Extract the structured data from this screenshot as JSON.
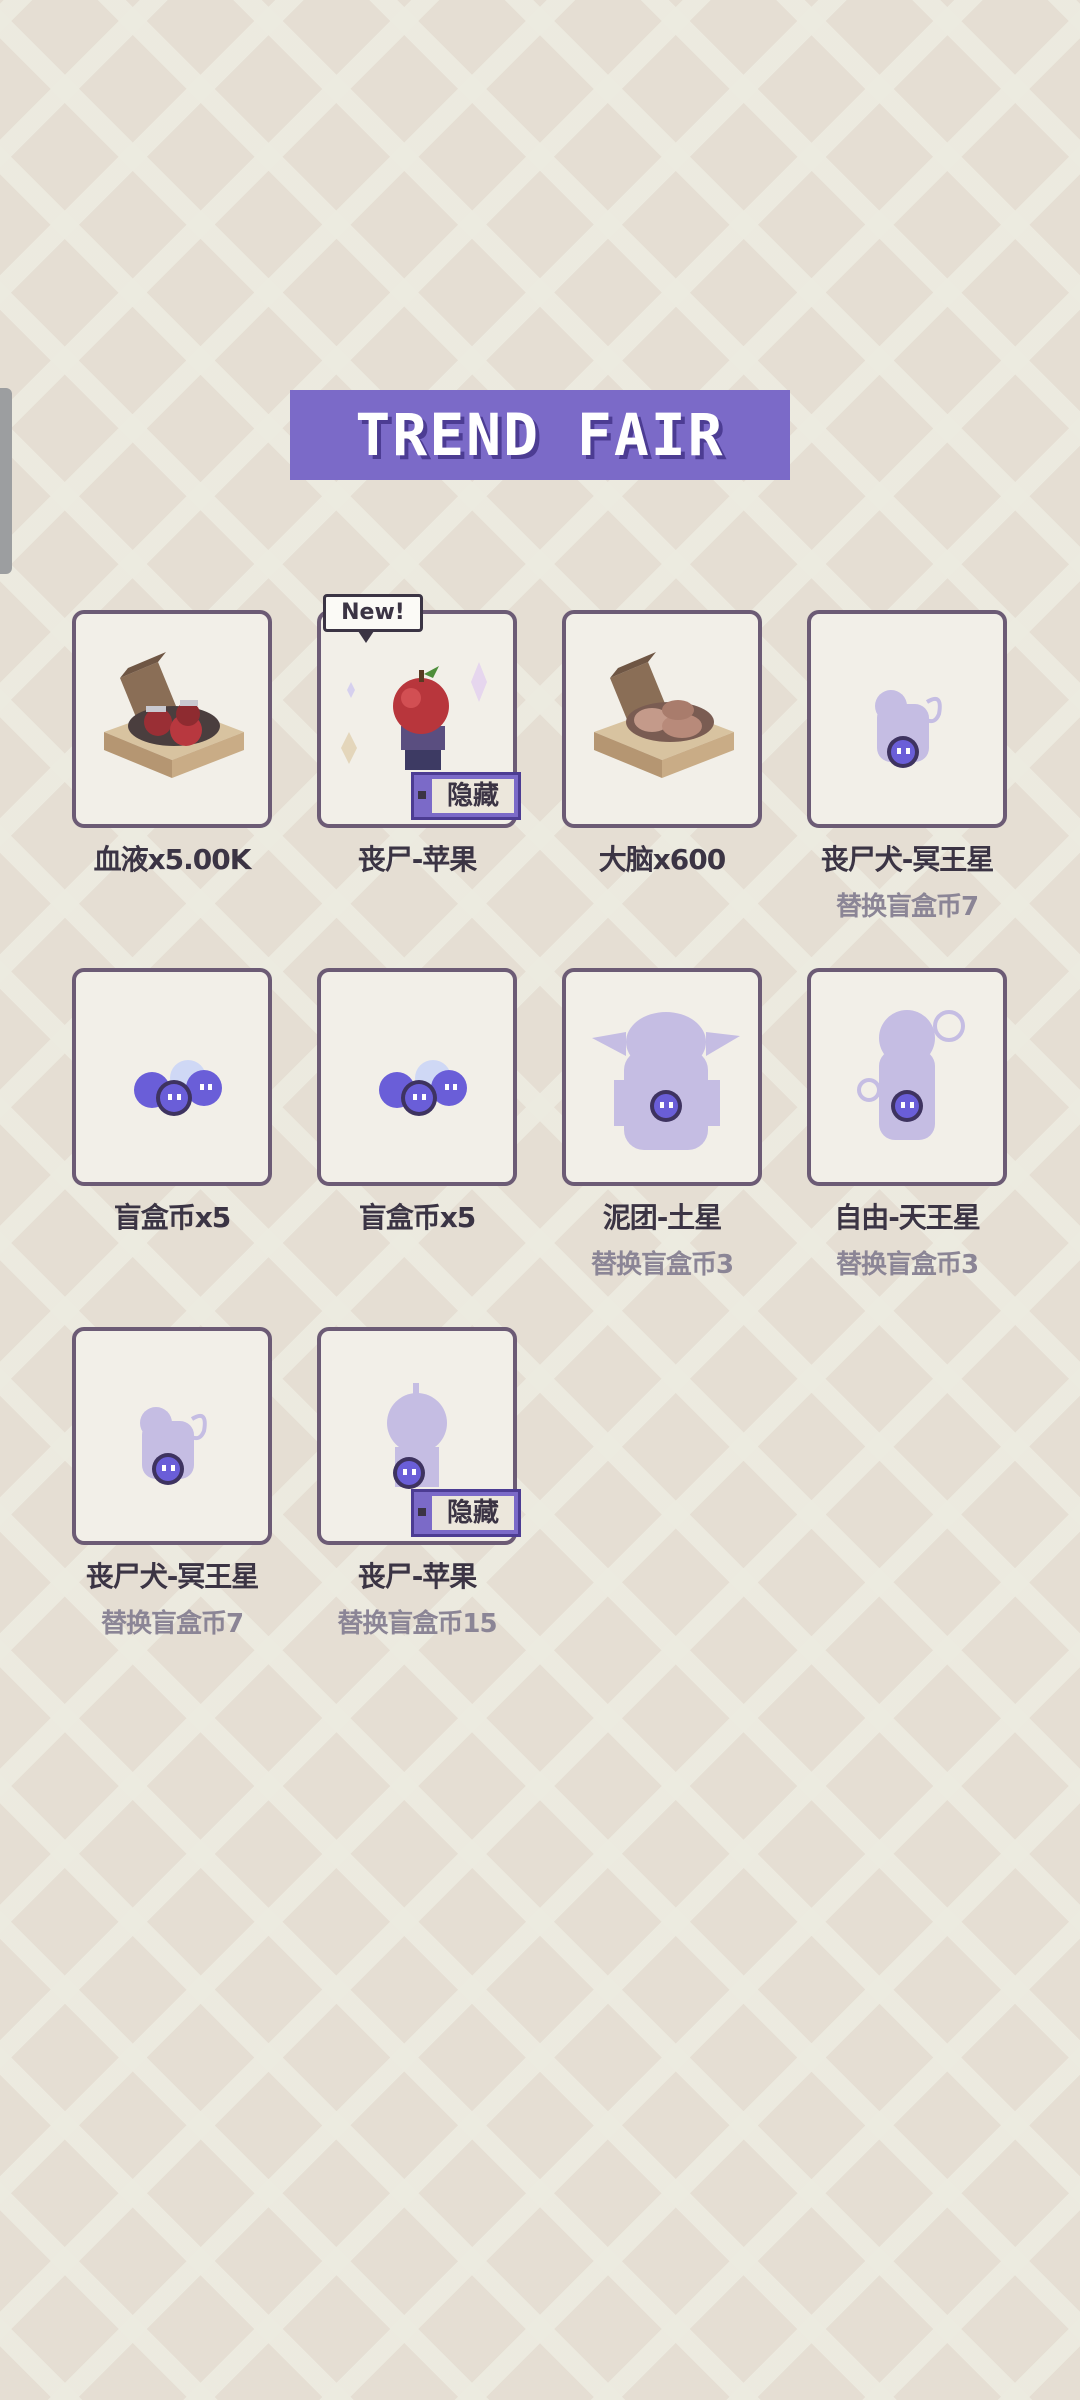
{
  "title": "TREND FAIR",
  "colors": {
    "background": "#e5ded3",
    "banner": "#7b6ac8",
    "card_border": "#6c5b75",
    "card_fill": "#f2efe8",
    "silhouette": "#c5bde3",
    "coin": "#6a5ed8"
  },
  "items": [
    {
      "name": "血液x5.00K",
      "sub": "",
      "icon": "blood-crate-icon",
      "new": false,
      "hidden": false
    },
    {
      "name": "丧尸-苹果",
      "sub": "",
      "icon": "zombie-apple-figure-icon",
      "new": true,
      "new_label": "New!",
      "hidden": true,
      "hidden_label": "隐藏"
    },
    {
      "name": "大脑x600",
      "sub": "",
      "icon": "brain-crate-icon",
      "new": false,
      "hidden": false
    },
    {
      "name": "丧尸犬-冥王星",
      "sub": "替换盲盒币7",
      "icon": "zombie-dog-silhouette-icon",
      "new": false,
      "hidden": false
    },
    {
      "name": "盲盒币x5",
      "sub": "",
      "icon": "blind-box-coins-icon",
      "new": false,
      "hidden": false
    },
    {
      "name": "盲盒币x5",
      "sub": "",
      "icon": "blind-box-coins-icon",
      "new": false,
      "hidden": false
    },
    {
      "name": "泥团-土星",
      "sub": "替换盲盒币3",
      "icon": "mud-blob-silhouette-icon",
      "new": false,
      "hidden": false
    },
    {
      "name": "自由-天王星",
      "sub": "替换盲盒币3",
      "icon": "liberty-silhouette-icon",
      "new": false,
      "hidden": false
    },
    {
      "name": "丧尸犬-冥王星",
      "sub": "替换盲盒币7",
      "icon": "zombie-dog-silhouette-icon",
      "new": false,
      "hidden": false
    },
    {
      "name": "丧尸-苹果",
      "sub": "替换盲盒币15",
      "icon": "zombie-apple-silhouette-icon",
      "new": false,
      "hidden": true,
      "hidden_label": "隐藏"
    }
  ]
}
